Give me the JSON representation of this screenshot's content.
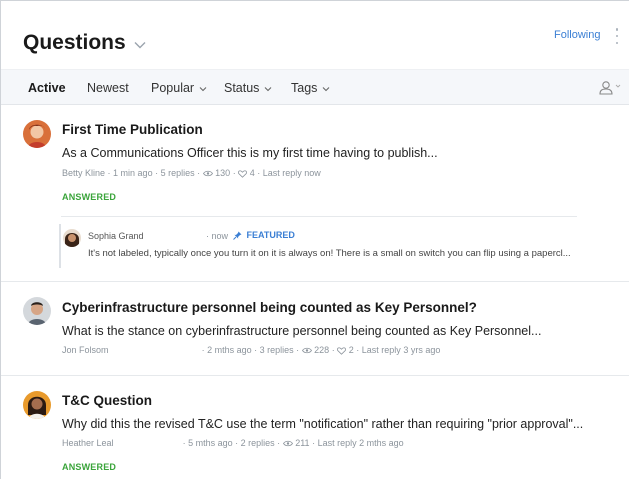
{
  "header": {
    "title": "Questions",
    "following_label": "Following"
  },
  "tabs": [
    {
      "label": "Active"
    },
    {
      "label": "Newest"
    },
    {
      "label": "Popular"
    },
    {
      "label": "Status"
    },
    {
      "label": "Tags"
    }
  ],
  "posts": [
    {
      "title": "First Time Publication",
      "excerpt": "As a Communications Officer this is my first time having to publish...",
      "author": "Betty Kline",
      "time": "1 min ago",
      "replies": "5 replies",
      "views": "130",
      "likes": "4",
      "last_reply": "Last reply",
      "last_reply_time": "now",
      "status": "ANSWERED",
      "reply": {
        "author": "Sophia Grand",
        "time": "now",
        "badge": "FEATURED",
        "text": "It's not labeled, typically once you turn it on it is always on! There is a small on switch you can flip using a papercl..."
      }
    },
    {
      "title": "Cyberinfrastructure personnel being counted as Key Personnel?",
      "excerpt": "What is the stance on cyberinfrastructure personnel being counted as Key Personnel...",
      "author": "Jon Folsom",
      "time": "2 mths ago",
      "replies": "3 replies",
      "views": "228",
      "likes": "2",
      "last_reply": "Last reply",
      "last_reply_time": "3 yrs ago"
    },
    {
      "title": "T&C Question",
      "excerpt": "Why did this the revised T&C use the term \"notification\" rather than requiring \"prior approval\"...",
      "author": "Heather Leal",
      "time": "5 mths ago",
      "replies": "2 replies",
      "views": "211",
      "last_reply": "Last reply",
      "last_reply_time": "2 mths ago",
      "status": "ANSWERED"
    }
  ],
  "colors": {
    "accent": "#3b7fd4",
    "answered": "#3aa43a",
    "tabbar_bg": "#f5f7fa"
  }
}
